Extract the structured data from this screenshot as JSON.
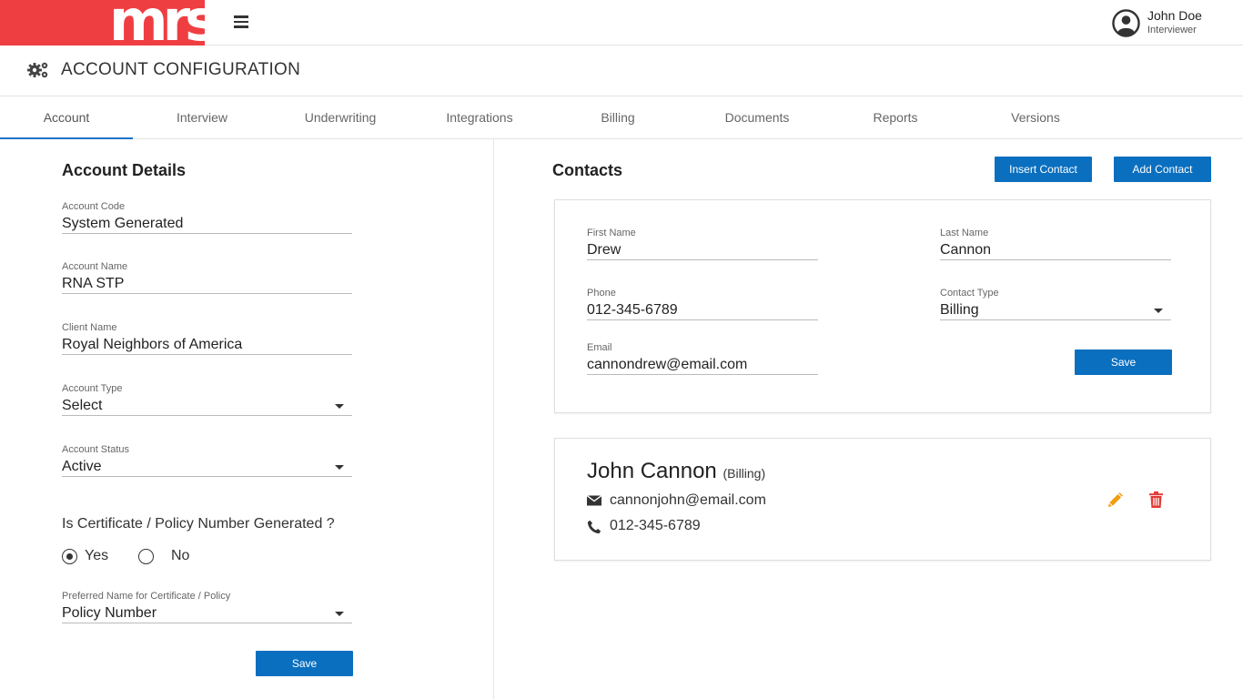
{
  "header": {
    "logo_text": "mrs",
    "user": {
      "name": "John Doe",
      "role": "Interviewer"
    }
  },
  "page": {
    "title": "ACCOUNT CONFIGURATION"
  },
  "tabs": [
    {
      "label": "Account",
      "active": true
    },
    {
      "label": "Interview"
    },
    {
      "label": "Underwriting"
    },
    {
      "label": "Integrations"
    },
    {
      "label": "Billing"
    },
    {
      "label": "Documents"
    },
    {
      "label": "Reports"
    },
    {
      "label": "Versions"
    }
  ],
  "account_details": {
    "title": "Account Details",
    "fields": {
      "account_code": {
        "label": "Account Code",
        "value": "System Generated"
      },
      "account_name": {
        "label": "Account Name",
        "value": "RNA STP"
      },
      "client_name": {
        "label": "Client Name",
        "value": "Royal Neighbors of America"
      },
      "account_type": {
        "label": "Account Type",
        "value": "Select"
      },
      "account_status": {
        "label": "Account Status",
        "value": "Active"
      },
      "preferred_name": {
        "label": "Preferred Name for Certificate / Policy",
        "value": "Policy Number"
      }
    },
    "certificate_question": "Is Certificate / Policy Number Generated ?",
    "radio_yes": "Yes",
    "radio_no": "No",
    "selected_radio": "Yes",
    "save_label": "Save"
  },
  "contacts": {
    "title": "Contacts",
    "insert_label": "Insert Contact",
    "add_label": "Add Contact",
    "form": {
      "first_name": {
        "label": "First Name",
        "value": "Drew"
      },
      "last_name": {
        "label": "Last Name",
        "value": "Cannon"
      },
      "phone": {
        "label": "Phone",
        "value": "012-345-6789"
      },
      "contact_type": {
        "label": "Contact Type",
        "value": "Billing"
      },
      "email": {
        "label": "Email",
        "value": "cannondrew@email.com"
      },
      "save_label": "Save"
    },
    "list": [
      {
        "name": "John Cannon",
        "type": "(Billing)",
        "email": "cannonjohn@email.com",
        "phone": "012-345-6789"
      }
    ]
  },
  "colors": {
    "brand_red": "#ef3e42",
    "primary_button": "#0a6fbf",
    "tab_active_underline": "#1a73c7",
    "edit_icon": "#f39c12",
    "delete_icon": "#e53935"
  },
  "icons": [
    "hamburger-icon",
    "user-avatar-icon",
    "gears-icon",
    "caret-down-icon",
    "envelope-icon",
    "phone-icon",
    "pencil-icon",
    "trash-icon"
  ]
}
